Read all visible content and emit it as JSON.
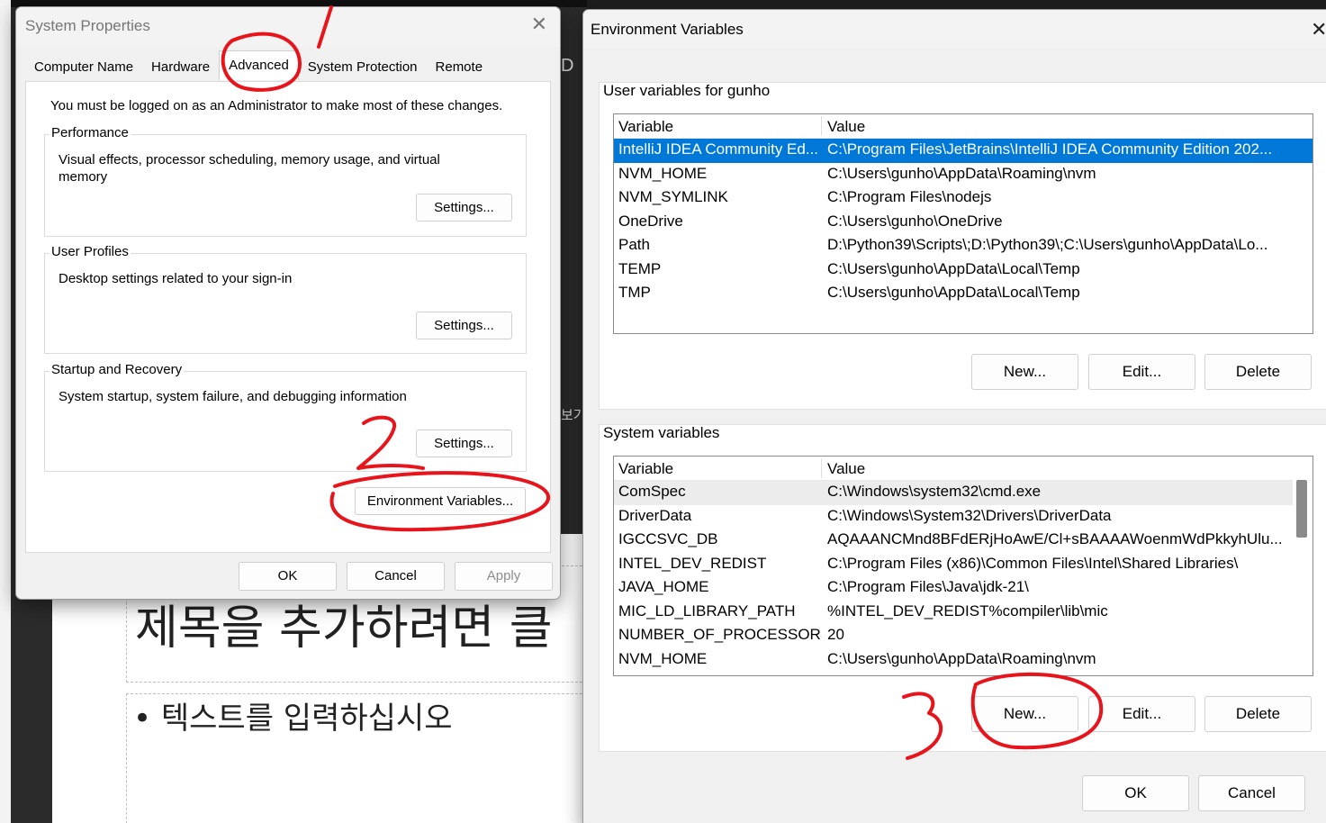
{
  "background": {
    "slide_title": "제목을 추가하려면 클",
    "slide_body": "• 텍스트를 입력하십시오",
    "partial_text_right": "D",
    "partial_text_korean": "보기"
  },
  "system_properties": {
    "title": "System Properties",
    "tabs": [
      "Computer Name",
      "Hardware",
      "Advanced",
      "System Protection",
      "Remote"
    ],
    "active_tab": "Advanced",
    "admin_notice": "You must be logged on as an Administrator to make most of these changes.",
    "performance": {
      "title": "Performance",
      "description": "Visual effects, processor scheduling, memory usage, and virtual memory",
      "button": "Settings..."
    },
    "user_profiles": {
      "title": "User Profiles",
      "description": "Desktop settings related to your sign-in",
      "button": "Settings..."
    },
    "startup_recovery": {
      "title": "Startup and Recovery",
      "description": "System startup, system failure, and debugging information",
      "button": "Settings..."
    },
    "env_button": "Environment Variables...",
    "ok": "OK",
    "cancel": "Cancel",
    "apply": "Apply"
  },
  "environment_variables": {
    "title": "Environment Variables",
    "user_section_label": "User variables for gunho",
    "column_variable": "Variable",
    "column_value": "Value",
    "user_vars": [
      {
        "name": "IntelliJ IDEA Community Ed...",
        "value": "C:\\Program Files\\JetBrains\\IntelliJ IDEA Community Edition 202..."
      },
      {
        "name": "NVM_HOME",
        "value": "C:\\Users\\gunho\\AppData\\Roaming\\nvm"
      },
      {
        "name": "NVM_SYMLINK",
        "value": "C:\\Program Files\\nodejs"
      },
      {
        "name": "OneDrive",
        "value": "C:\\Users\\gunho\\OneDrive"
      },
      {
        "name": "Path",
        "value": "D:\\Python39\\Scripts\\;D:\\Python39\\;C:\\Users\\gunho\\AppData\\Lo..."
      },
      {
        "name": "TEMP",
        "value": "C:\\Users\\gunho\\AppData\\Local\\Temp"
      },
      {
        "name": "TMP",
        "value": "C:\\Users\\gunho\\AppData\\Local\\Temp"
      }
    ],
    "system_section_label": "System variables",
    "system_vars": [
      {
        "name": "ComSpec",
        "value": "C:\\Windows\\system32\\cmd.exe"
      },
      {
        "name": "DriverData",
        "value": "C:\\Windows\\System32\\Drivers\\DriverData"
      },
      {
        "name": "IGCCSVC_DB",
        "value": "AQAAANCMnd8BFdERjHoAwE/Cl+sBAAAAWoenmWdPkkyhUlu..."
      },
      {
        "name": "INTEL_DEV_REDIST",
        "value": "C:\\Program Files (x86)\\Common Files\\Intel\\Shared Libraries\\"
      },
      {
        "name": "JAVA_HOME",
        "value": "C:\\Program Files\\Java\\jdk-21\\"
      },
      {
        "name": "MIC_LD_LIBRARY_PATH",
        "value": "%INTEL_DEV_REDIST%compiler\\lib\\mic"
      },
      {
        "name": "NUMBER_OF_PROCESSORS",
        "value": "20"
      },
      {
        "name": "NVM_HOME",
        "value": "C:\\Users\\gunho\\AppData\\Roaming\\nvm"
      }
    ],
    "new_button": "New...",
    "edit_button": "Edit...",
    "delete_button": "Delete",
    "ok": "OK",
    "cancel": "Cancel"
  },
  "annotations": {
    "color": "#e8141b",
    "step1": "1",
    "step2": "2",
    "step3": "3"
  }
}
